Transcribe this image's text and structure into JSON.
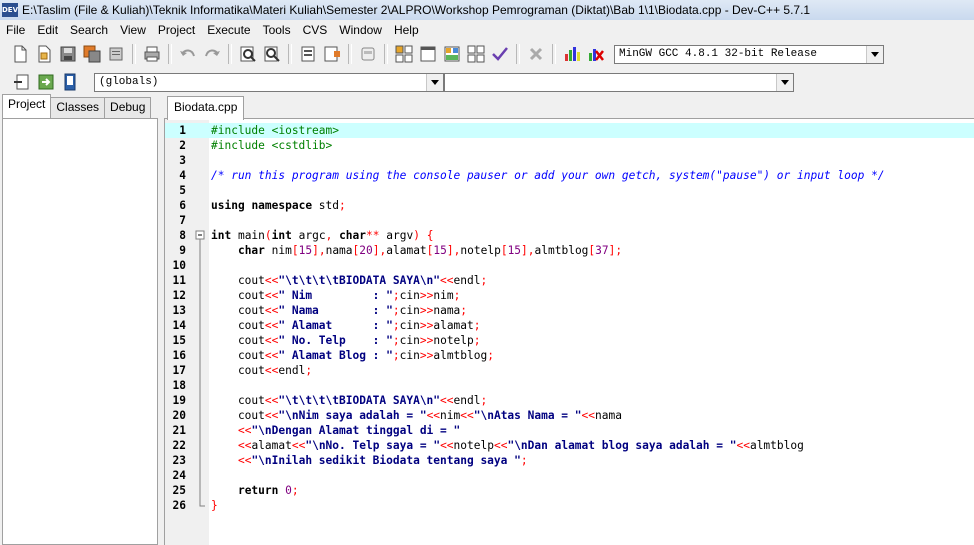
{
  "window": {
    "title": "E:\\Taslim (File & Kuliah)\\Teknik Informatika\\Materi Kuliah\\Semester 2\\ALPRO\\Workshop Pemrograman (Diktat)\\Bab 1\\1\\Biodata.cpp - Dev-C++ 5.7.1",
    "icon_text": "DEV"
  },
  "menu": [
    "File",
    "Edit",
    "Search",
    "View",
    "Project",
    "Execute",
    "Tools",
    "CVS",
    "Window",
    "Help"
  ],
  "toolbar": {
    "compiler_select": "MinGW GCC 4.8.1 32-bit Release",
    "scope_select": "(globals)",
    "member_select": ""
  },
  "left_panel": {
    "tabs": [
      "Project",
      "Classes",
      "Debug"
    ],
    "active_tab": "Project"
  },
  "editor": {
    "file_tab": "Biodata.cpp",
    "current_line": 1,
    "lines": [
      [
        [
          "pp",
          "#include <iostream>"
        ]
      ],
      [
        [
          "pp",
          "#include <cstdlib>"
        ]
      ],
      [],
      [
        [
          "cm",
          "/* run this program using the console pauser or add your own getch, system(\"pause\") or input loop */"
        ]
      ],
      [],
      [
        [
          "kw",
          "using"
        ],
        [
          "id",
          " "
        ],
        [
          "kw",
          "namespace"
        ],
        [
          "id",
          " std"
        ],
        [
          "sy",
          ";"
        ]
      ],
      [],
      [
        [
          "kw",
          "int"
        ],
        [
          "id",
          " main"
        ],
        [
          "sy",
          "("
        ],
        [
          "kw",
          "int"
        ],
        [
          "id",
          " argc"
        ],
        [
          "sy",
          ","
        ],
        [
          "id",
          " "
        ],
        [
          "kw",
          "char"
        ],
        [
          "sy",
          "**"
        ],
        [
          "id",
          " argv"
        ],
        [
          "sy",
          ")"
        ],
        [
          "id",
          " "
        ],
        [
          "sy",
          "{"
        ]
      ],
      [
        [
          "id",
          "    "
        ],
        [
          "kw",
          "char"
        ],
        [
          "id",
          " nim"
        ],
        [
          "sy",
          "["
        ],
        [
          "nm",
          "15"
        ],
        [
          "sy",
          "],"
        ],
        [
          "id",
          "nama"
        ],
        [
          "sy",
          "["
        ],
        [
          "nm",
          "20"
        ],
        [
          "sy",
          "],"
        ],
        [
          "id",
          "alamat"
        ],
        [
          "sy",
          "["
        ],
        [
          "nm",
          "15"
        ],
        [
          "sy",
          "],"
        ],
        [
          "id",
          "notelp"
        ],
        [
          "sy",
          "["
        ],
        [
          "nm",
          "15"
        ],
        [
          "sy",
          "],"
        ],
        [
          "id",
          "almtblog"
        ],
        [
          "sy",
          "["
        ],
        [
          "nm",
          "37"
        ],
        [
          "sy",
          "];"
        ]
      ],
      [],
      [
        [
          "id",
          "    cout"
        ],
        [
          "sy",
          "<<"
        ],
        [
          "st",
          "\"\\t\\t\\t\\tBIODATA SAYA\\n\""
        ],
        [
          "sy",
          "<<"
        ],
        [
          "id",
          "endl"
        ],
        [
          "sy",
          ";"
        ]
      ],
      [
        [
          "id",
          "    cout"
        ],
        [
          "sy",
          "<<"
        ],
        [
          "st",
          "\" Nim         : \""
        ],
        [
          "sy",
          ";"
        ],
        [
          "id",
          "cin"
        ],
        [
          "sy",
          ">>"
        ],
        [
          "id",
          "nim"
        ],
        [
          "sy",
          ";"
        ]
      ],
      [
        [
          "id",
          "    cout"
        ],
        [
          "sy",
          "<<"
        ],
        [
          "st",
          "\" Nama        : \""
        ],
        [
          "sy",
          ";"
        ],
        [
          "id",
          "cin"
        ],
        [
          "sy",
          ">>"
        ],
        [
          "id",
          "nama"
        ],
        [
          "sy",
          ";"
        ]
      ],
      [
        [
          "id",
          "    cout"
        ],
        [
          "sy",
          "<<"
        ],
        [
          "st",
          "\" Alamat      : \""
        ],
        [
          "sy",
          ";"
        ],
        [
          "id",
          "cin"
        ],
        [
          "sy",
          ">>"
        ],
        [
          "id",
          "alamat"
        ],
        [
          "sy",
          ";"
        ]
      ],
      [
        [
          "id",
          "    cout"
        ],
        [
          "sy",
          "<<"
        ],
        [
          "st",
          "\" No. Telp    : \""
        ],
        [
          "sy",
          ";"
        ],
        [
          "id",
          "cin"
        ],
        [
          "sy",
          ">>"
        ],
        [
          "id",
          "notelp"
        ],
        [
          "sy",
          ";"
        ]
      ],
      [
        [
          "id",
          "    cout"
        ],
        [
          "sy",
          "<<"
        ],
        [
          "st",
          "\" Alamat Blog : \""
        ],
        [
          "sy",
          ";"
        ],
        [
          "id",
          "cin"
        ],
        [
          "sy",
          ">>"
        ],
        [
          "id",
          "almtblog"
        ],
        [
          "sy",
          ";"
        ]
      ],
      [
        [
          "id",
          "    cout"
        ],
        [
          "sy",
          "<<"
        ],
        [
          "id",
          "endl"
        ],
        [
          "sy",
          ";"
        ]
      ],
      [],
      [
        [
          "id",
          "    cout"
        ],
        [
          "sy",
          "<<"
        ],
        [
          "st",
          "\"\\t\\t\\t\\tBIODATA SAYA\\n\""
        ],
        [
          "sy",
          "<<"
        ],
        [
          "id",
          "endl"
        ],
        [
          "sy",
          ";"
        ]
      ],
      [
        [
          "id",
          "    cout"
        ],
        [
          "sy",
          "<<"
        ],
        [
          "st",
          "\"\\nNim saya adalah = \""
        ],
        [
          "sy",
          "<<"
        ],
        [
          "id",
          "nim"
        ],
        [
          "sy",
          "<<"
        ],
        [
          "st",
          "\"\\nAtas Nama = \""
        ],
        [
          "sy",
          "<<"
        ],
        [
          "id",
          "nama"
        ]
      ],
      [
        [
          "id",
          "    "
        ],
        [
          "sy",
          "<<"
        ],
        [
          "st",
          "\"\\nDengan Alamat tinggal di = \""
        ]
      ],
      [
        [
          "id",
          "    "
        ],
        [
          "sy",
          "<<"
        ],
        [
          "id",
          "alamat"
        ],
        [
          "sy",
          "<<"
        ],
        [
          "st",
          "\"\\nNo. Telp saya = \""
        ],
        [
          "sy",
          "<<"
        ],
        [
          "id",
          "notelp"
        ],
        [
          "sy",
          "<<"
        ],
        [
          "st",
          "\"\\nDan alamat blog saya adalah = \""
        ],
        [
          "sy",
          "<<"
        ],
        [
          "id",
          "almtblog"
        ]
      ],
      [
        [
          "id",
          "    "
        ],
        [
          "sy",
          "<<"
        ],
        [
          "st",
          "\"\\nInilah sedikit Biodata tentang saya \""
        ],
        [
          "sy",
          ";"
        ]
      ],
      [],
      [
        [
          "id",
          "    "
        ],
        [
          "kw",
          "return"
        ],
        [
          "id",
          " "
        ],
        [
          "nm",
          "0"
        ],
        [
          "sy",
          ";"
        ]
      ],
      [
        [
          "sy",
          "}"
        ]
      ]
    ]
  }
}
